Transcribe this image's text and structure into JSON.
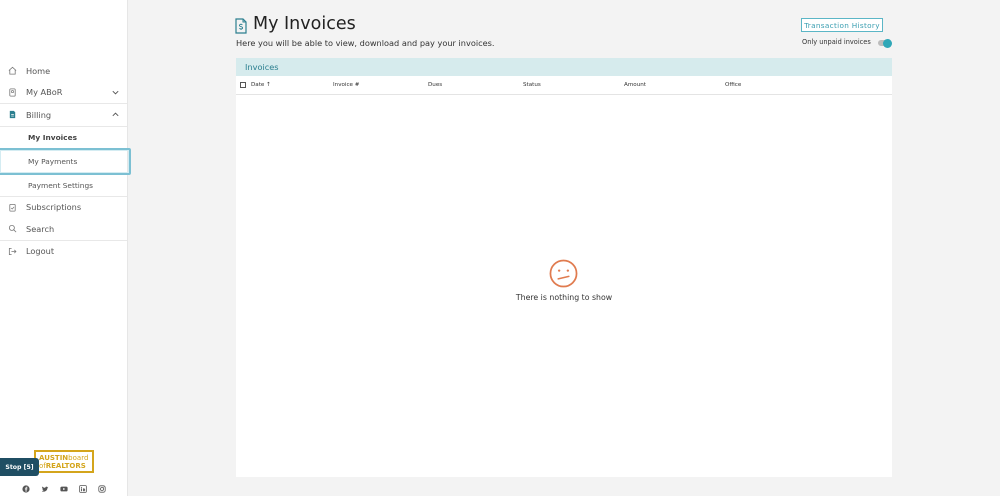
{
  "sidebar": {
    "items": [
      {
        "label": "Home",
        "icon": "home-icon"
      },
      {
        "label": "My ABoR",
        "icon": "badge-icon"
      },
      {
        "label": "Billing",
        "icon": "document-icon"
      },
      {
        "label": "Subscriptions",
        "icon": "clipboard-icon"
      },
      {
        "label": "Search",
        "icon": "search-icon"
      },
      {
        "label": "Logout",
        "icon": "logout-icon"
      }
    ],
    "billing_sub": [
      {
        "label": "My Invoices"
      },
      {
        "label": "My Payments"
      },
      {
        "label": "Payment Settings"
      }
    ],
    "stop_label": "Stop [5]",
    "logo": {
      "line1": "AUSTIN",
      "line1b": "board",
      "line2": "of",
      "line2b": "REALTORS"
    }
  },
  "header": {
    "title": "My Invoices",
    "subtitle": "Here you will be able to view, download and pay your invoices.",
    "transaction_button": "Transaction History",
    "toggle_label": "Only unpaid invoices",
    "toggle_on": true
  },
  "panel": {
    "title": "Invoices",
    "columns": [
      "Date ↑",
      "Invoice #",
      "Dues",
      "Status",
      "Amount",
      "Office"
    ],
    "empty_message": "There is nothing to show"
  },
  "colors": {
    "accent": "#2fa7b7",
    "panel_header": "#d6ebed",
    "empty_icon": "#e07b4f",
    "logo_gold": "#d4a51c"
  }
}
